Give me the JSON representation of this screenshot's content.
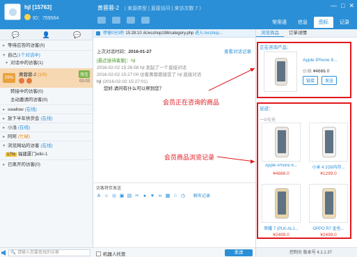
{
  "user": {
    "name": "hjl [15763]",
    "id": "ID：759564"
  },
  "window_controls": [
    "—",
    "□",
    "✕"
  ],
  "top_nav": [
    "常用语",
    "信息",
    "图标",
    "记录"
  ],
  "conversation_header": {
    "name": "黄蓉蓉-2",
    "meta": "（ 来源类型 | 直接访问 | 来访次数 7 ）"
  },
  "left_tabs": [
    "💬",
    "👤",
    "💬"
  ],
  "tree": [
    {
      "label": "等待应答的访客(0)",
      "kind": "group"
    },
    {
      "label": "自己",
      "suffix": "(1个对话中)",
      "kind": "group"
    },
    {
      "label": "对话中的访客(1)",
      "kind": "child"
    }
  ],
  "selected_visitor": {
    "pct": "29%",
    "name": "黄蓉蓉-2",
    "count": "(1/0)",
    "badge": "淘宝",
    "time": "00:03"
  },
  "tree2": [
    {
      "label": "转接中的访客(0)",
      "kind": "child"
    },
    {
      "label": "主动邀请的访客(0)",
      "kind": "child"
    },
    {
      "label": "swallow",
      "suffix": "(在线)",
      "kind": "group"
    },
    {
      "label": "放下半年供货会",
      "suffix": "(在线)",
      "kind": "group"
    },
    {
      "label": "小浅",
      "suffix": "(在线)",
      "kind": "group"
    },
    {
      "label": "阿阿",
      "suffix": "(忙碌)",
      "kind": "group",
      "busy": true
    },
    {
      "label": "浏览网站的访客",
      "suffix": "(在线)",
      "kind": "group"
    }
  ],
  "browsing_visitor": {
    "pct": "17%",
    "name": "福建厦门wiki-1"
  },
  "tree3": [
    {
      "label": "已离开的访客(0)",
      "kind": "group"
    }
  ],
  "left_search_placeholder": "请输入您要查找的访客",
  "url_bar": {
    "prefix": "停留0分3秒",
    "time": "15:28:10",
    "from": "从/ecshop198/category.php",
    "action": "进入:/ecshop..."
  },
  "last_visit": {
    "label": "上次对话时间：",
    "date": "2016-01-27"
  },
  "history_link": "查看对话记录",
  "messages": {
    "system_title": "[最近接待客服]：hjl",
    "line1": "2016-02-02 15:26:58 hjl 发起了一个直接对话",
    "line2": "2016-02-02 15:27:00 访客黄蓉蓉接受了 hjl 直接对话",
    "sender": "hjl",
    "sender_time": "(2016-02-02 15:27:01)",
    "body": "您好,请问有什么可以帮到您？"
  },
  "composer": {
    "label": "访客将存发送",
    "history": "聊天记录"
  },
  "robot_toggle": "机器人托管",
  "send_button": "发送",
  "right_tabs": [
    "浏览商品",
    "订单详情"
  ],
  "current_product": {
    "section_title": "正在咨询产品：",
    "title": "Apple iPhone 6...",
    "price_label": "价格",
    "price": "¥4666.0",
    "buttons": [
      "链接",
      "发送"
    ]
  },
  "browsed": {
    "section_title": "足迹：",
    "day": "一0今天",
    "items": [
      {
        "title": "Apple iPhone 6...",
        "price": "¥4666.0"
      },
      {
        "title": "小米 4 2G8内存...",
        "price": "¥1299.0"
      },
      {
        "title": "荣耀 7 (PLK-AL1...",
        "price": "¥2499.0"
      },
      {
        "title": "OPPO R7 金色...",
        "price": "¥2499.0"
      }
    ]
  },
  "right_footer": "控制台 版本号 4.1.1.37",
  "annotations": {
    "consulting": "会员正在咨询的商品",
    "browsing": "会员商品浏览记录"
  },
  "colors": {
    "accent": "#2a8fd6",
    "annotation": "#e0161b",
    "price": "#e03b2c"
  }
}
